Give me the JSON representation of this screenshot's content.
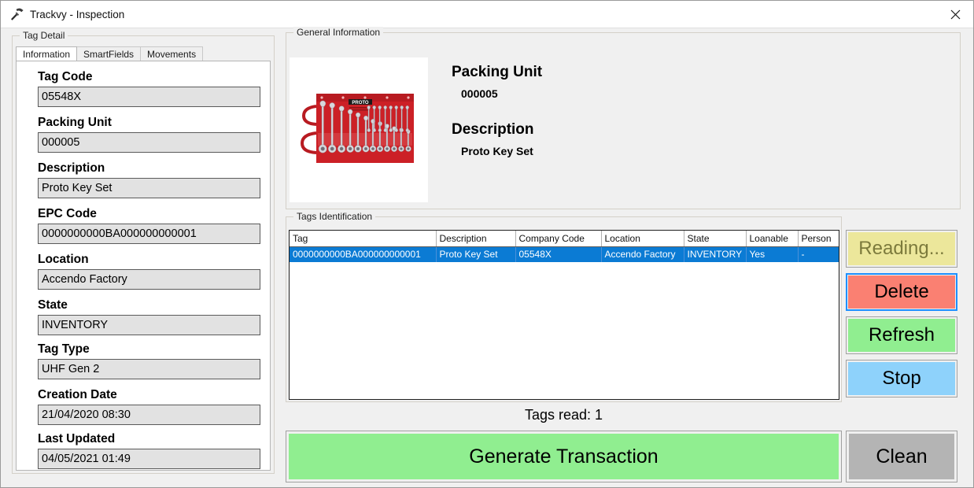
{
  "window": {
    "title": "Trackvy - Inspection",
    "app_icon": "hammer-icon",
    "close_icon": "close-icon"
  },
  "tag_detail": {
    "group_title": "Tag Detail",
    "tabs": [
      {
        "label": "Information",
        "active": true
      },
      {
        "label": "SmartFields",
        "active": false
      },
      {
        "label": "Movements",
        "active": false
      }
    ],
    "fields": [
      {
        "label": "Tag Code",
        "value": "05548X"
      },
      {
        "label": "Packing Unit",
        "value": "000005"
      },
      {
        "label": "Description",
        "value": "Proto Key Set"
      },
      {
        "label": "EPC Code",
        "value": "0000000000BA000000000001"
      },
      {
        "label": "Location",
        "value": "Accendo Factory"
      },
      {
        "label": "State",
        "value": "INVENTORY"
      },
      {
        "label": "Tag Type",
        "value": "UHF Gen 2"
      },
      {
        "label": "Creation Date",
        "value": "21/04/2020 08:30"
      },
      {
        "label": "Last Updated",
        "value": "04/05/2021 01:49"
      }
    ]
  },
  "general_information": {
    "group_title": "General Information",
    "image_alt": "proto-key-set-product-image",
    "packing_unit_heading": "Packing Unit",
    "packing_unit_value": "000005",
    "description_heading": "Description",
    "description_value": "Proto Key Set"
  },
  "tags_identification": {
    "group_title": "Tags Identification",
    "columns": [
      "Tag",
      "Description",
      "Company Code",
      "Location",
      "State",
      "Loanable",
      "Person"
    ],
    "rows": [
      {
        "selected": true,
        "cells": [
          "0000000000BA000000000001",
          "Proto Key Set",
          "05548X",
          "Accendo Factory",
          "INVENTORY",
          "Yes",
          "-"
        ]
      }
    ]
  },
  "actions": {
    "reading": "Reading...",
    "delete": "Delete",
    "refresh": "Refresh",
    "stop": "Stop"
  },
  "footer": {
    "tags_read": "Tags read: 1",
    "generate_transaction": "Generate Transaction",
    "clean": "Clean"
  },
  "colors": {
    "window_bg": "#f0f0f0",
    "reading_bg": "#ece79b",
    "reading_text": "#7c7a3c",
    "delete_bg": "#fa8072",
    "focus_ring": "#1e90ff",
    "refresh_bg": "#90ee90",
    "stop_bg": "#8ed2fb",
    "generate_bg": "#90ee90",
    "clean_bg": "#b4b4b4",
    "row_selected_bg": "#0b7bd4",
    "input_bg": "#e2e2e2"
  }
}
